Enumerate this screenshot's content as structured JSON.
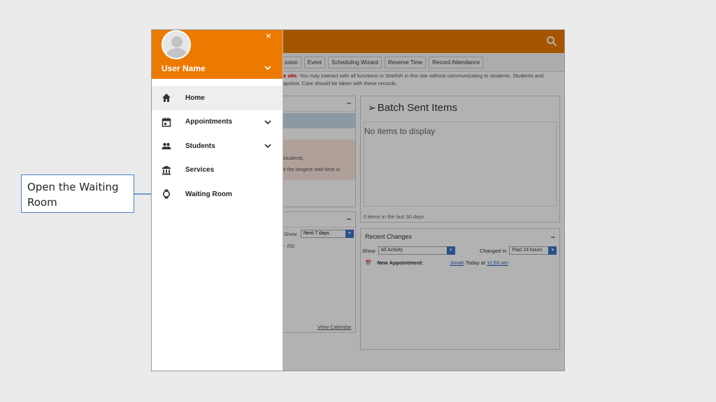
{
  "callout": {
    "text_line1": "Open the Waiting",
    "text_line2": "Room"
  },
  "drawer": {
    "user_name": "User Name",
    "close_symbol": "×",
    "items": [
      {
        "label": "Home",
        "icon": "home-icon",
        "has_chevron": false,
        "active": true
      },
      {
        "label": "Appointments",
        "icon": "calendar-icon",
        "has_chevron": true
      },
      {
        "label": "Students",
        "icon": "people-icon",
        "has_chevron": true
      },
      {
        "label": "Services",
        "icon": "institution-icon",
        "has_chevron": false
      },
      {
        "label": "Waiting Room",
        "icon": "watch-icon",
        "has_chevron": false
      }
    ]
  },
  "toolbar": {
    "buttons": [
      "ssion",
      "Event",
      "Scheduling Wizard",
      "Reserve Time",
      "Record Attendance"
    ]
  },
  "notice": {
    "red": "e site.",
    "line1": " You may interact with all functions in Starfish in this site without communicating to students. Students and",
    "line2": "apshot. Care should be taken with these records."
  },
  "left_fragments": {
    "students": "r students.",
    "wait": "nd the longest wait time is",
    "show": "Show",
    "next": "Next 7 days",
    "rd": "- RD",
    "view_calendar": "View Calendar"
  },
  "batch": {
    "title": "Batch Sent Items",
    "empty": "No items to display",
    "footer": "0 items in the last 30 days"
  },
  "recent_changes": {
    "title": "Recent Changes",
    "show_label": "Show",
    "show_value": "All Activity",
    "changed_label": "Changed in",
    "changed_value": "Past 24 hours",
    "item_type": "New Appointment:",
    "item_user": "Jonah",
    "item_when": "Today at",
    "item_time": "11:53 am"
  },
  "colors": {
    "brand": "#ed7a00",
    "accent_blue": "#3b74c7",
    "callout_border": "#4a7fc4"
  }
}
